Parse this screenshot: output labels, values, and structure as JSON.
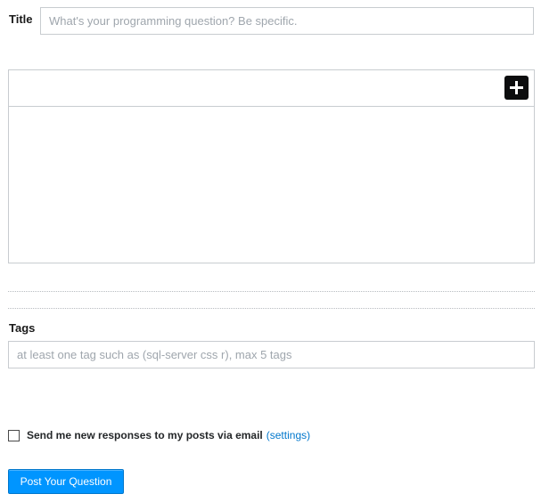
{
  "title_field": {
    "label": "Title",
    "value": "",
    "placeholder": "What's your programming question? Be specific."
  },
  "editor": {
    "insert_icon": "plus-icon",
    "body_value": ""
  },
  "tags_field": {
    "label": "Tags",
    "value": "",
    "placeholder": "at least one tag such as (sql-server css r), max 5 tags"
  },
  "notify": {
    "checked": false,
    "label": "Send me new responses to my posts via email",
    "settings_link": "(settings)"
  },
  "submit": {
    "label": "Post Your Question"
  },
  "colors": {
    "accent": "#0095ff",
    "link": "#0077cc",
    "border": "#c8ccd0",
    "placeholder": "#9fa6ad"
  }
}
